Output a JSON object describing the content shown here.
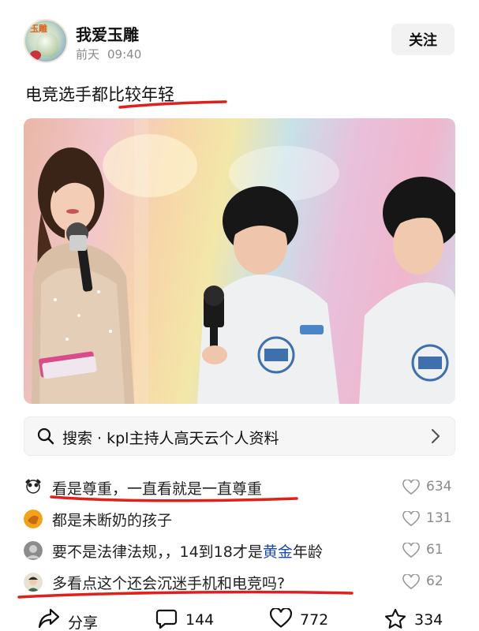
{
  "post": {
    "author": "我爱玉雕",
    "avatar_badge": "玉雕",
    "date": "前天",
    "time": "09:40",
    "follow_label": "关注",
    "title": "电竞选手都比较年轻"
  },
  "search": {
    "text": "搜索 · kpl主持人高天云个人资料",
    "icon": "search-icon"
  },
  "comments": [
    {
      "text": "看是尊重，一直看就是一直尊重",
      "likes": "634"
    },
    {
      "text": "都是未断奶的孩子",
      "likes": "131"
    },
    {
      "text_before": "要不是法律法规，，14到18才是",
      "text_highlight": "黄金",
      "text_after": "年龄",
      "likes": "61"
    },
    {
      "text": "多看点这个还会沉迷手机和电竞吗?",
      "likes": "62"
    }
  ],
  "actions": {
    "share_label": "分享",
    "comment_count": "144",
    "like_count": "772",
    "favorite_count": "334"
  },
  "colors": {
    "underline": "#e0201c",
    "highlight": "#1d4aa8",
    "muted": "#8a8a8a"
  }
}
